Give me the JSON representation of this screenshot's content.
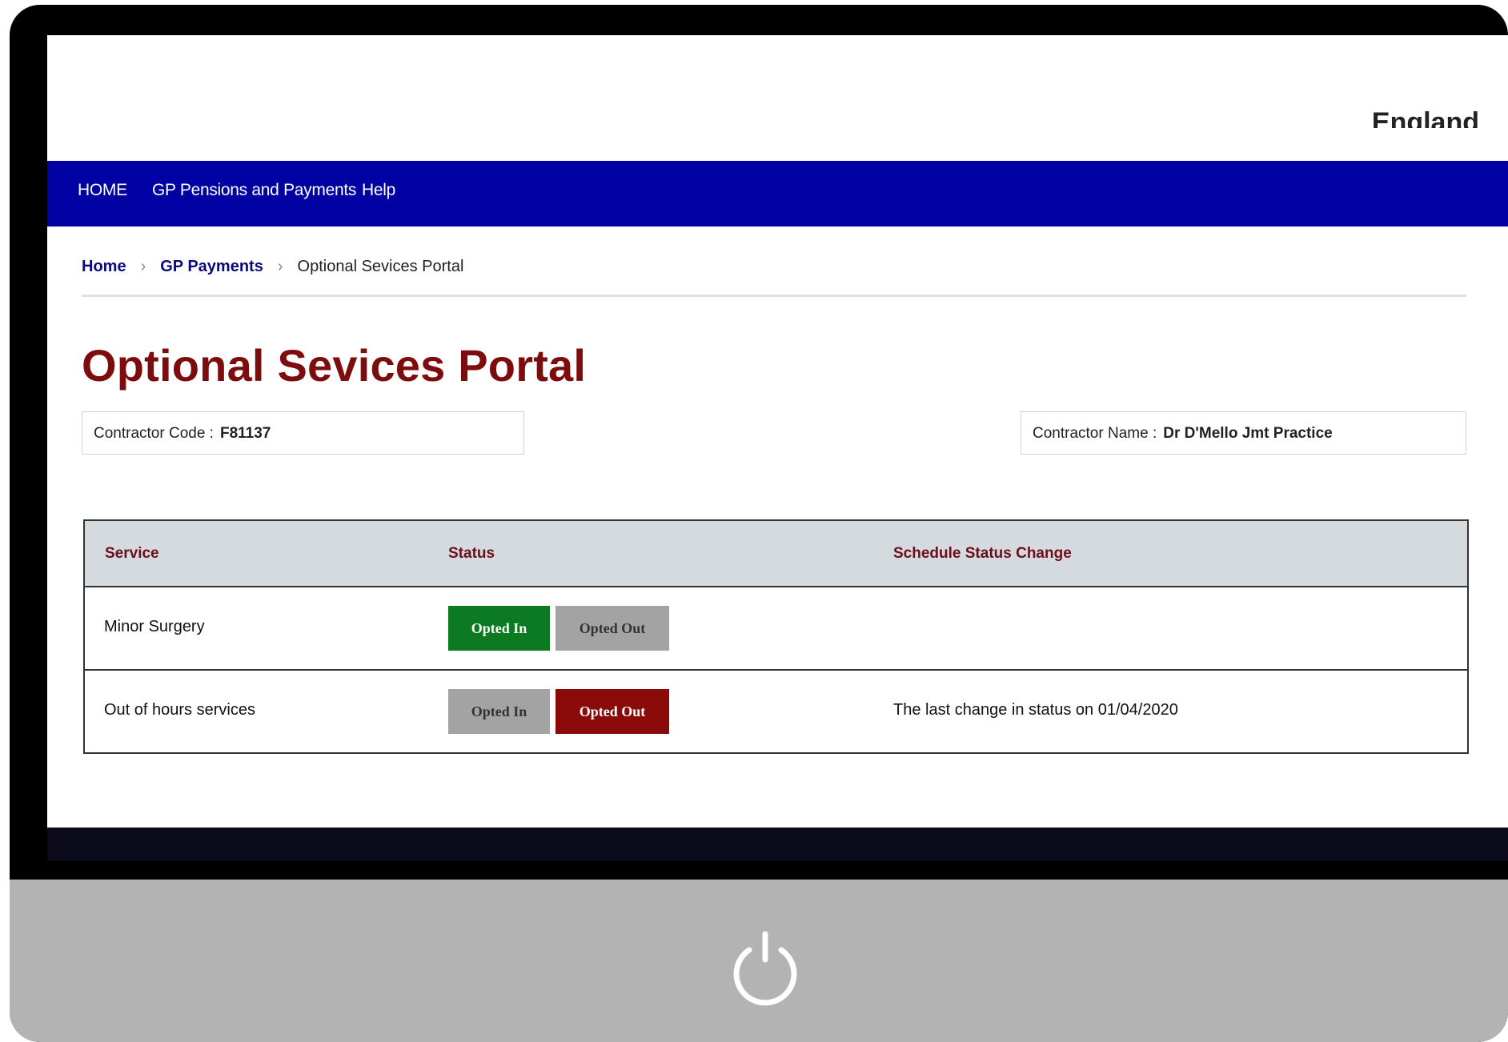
{
  "header": {
    "brand_text": "England"
  },
  "nav": {
    "items": [
      "HOME",
      "GP Pensions and Payments",
      "Help"
    ]
  },
  "breadcrumb": {
    "home": "Home",
    "gp_payments": "GP Payments",
    "current": "Optional Sevices Portal",
    "separator": ">"
  },
  "page": {
    "title": "Optional Sevices Portal"
  },
  "contractor": {
    "code_label": "Contractor Code :",
    "code_value": "F81137",
    "name_label": "Contractor Name :",
    "name_value": "Dr D'Mello Jmt Practice"
  },
  "table": {
    "headers": {
      "service": "Service",
      "status": "Status",
      "schedule": "Schedule Status Change"
    },
    "rows": [
      {
        "service": "Minor Surgery",
        "opted_in_label": "Opted In",
        "opted_out_label": "Opted Out",
        "status": "Opted In",
        "schedule": ""
      },
      {
        "service": "Out of hours services",
        "opted_in_label": "Opted In",
        "opted_out_label": "Opted Out",
        "status": "Opted Out",
        "schedule": "The last change in status on 01/04/2020"
      }
    ]
  },
  "colors": {
    "nav_bg": "#0000a3",
    "title": "#7d0c0c",
    "opted_in_active": "#0c7a22",
    "opted_out_active": "#8b0b0b",
    "inactive": "#a3a3a3"
  },
  "icons": {
    "power": "power-icon",
    "separator": "chevron-right-icon"
  }
}
